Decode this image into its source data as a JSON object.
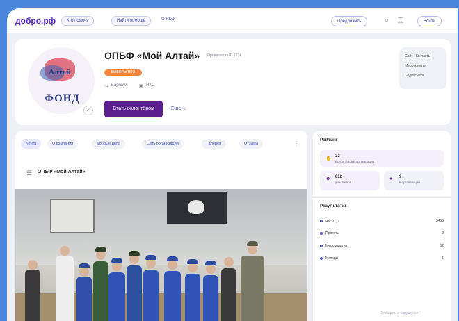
{
  "nav": {
    "logo": "добро.рф",
    "pills": [
      "Кто помочь",
      "Найти помощь"
    ],
    "link": "О НКО",
    "create_label": "Предложить",
    "login_label": "Войти"
  },
  "profile": {
    "title": "ОПБФ «Мой Алтай»",
    "subtitle": "Организация ID 1234",
    "tag": "ВЫБОРЫ НКО",
    "meta_1": "Барнаул",
    "meta_2": "НКО",
    "join_label": "Стать волонтёром",
    "more_label": "Ещё",
    "avatar_text_top": "Алтай",
    "avatar_text_bottom": "ФОНД",
    "contacts": [
      "Сайт / Контакты",
      "Мероприятия",
      "Подписчики"
    ]
  },
  "tabs": [
    "Лента",
    "О компании",
    "Добрые дела",
    "Сеть организаций",
    "Галерея",
    "Отзывы"
  ],
  "post": {
    "author": "ОПБФ «Мой Алтай»"
  },
  "rating": {
    "title": "Рейтинг",
    "cards": [
      {
        "value": "33",
        "label": "Волонтёров в организации"
      },
      {
        "value": "812",
        "label": "участников"
      },
      {
        "value": "9",
        "label": "в организации"
      }
    ]
  },
  "results": {
    "title": "Результаты",
    "rows": [
      {
        "label": "Часы ⓘ",
        "value": "3453"
      },
      {
        "label": "Проекты",
        "value": "3"
      },
      {
        "label": "Мероприятия",
        "value": "12"
      },
      {
        "label": "Методы",
        "value": "1"
      }
    ]
  },
  "footer": {
    "note": "Сообщить о нарушении"
  },
  "colors": {
    "accent": "#5a1f8c",
    "tag": "#f0863c",
    "frame": "#4a86d9"
  }
}
